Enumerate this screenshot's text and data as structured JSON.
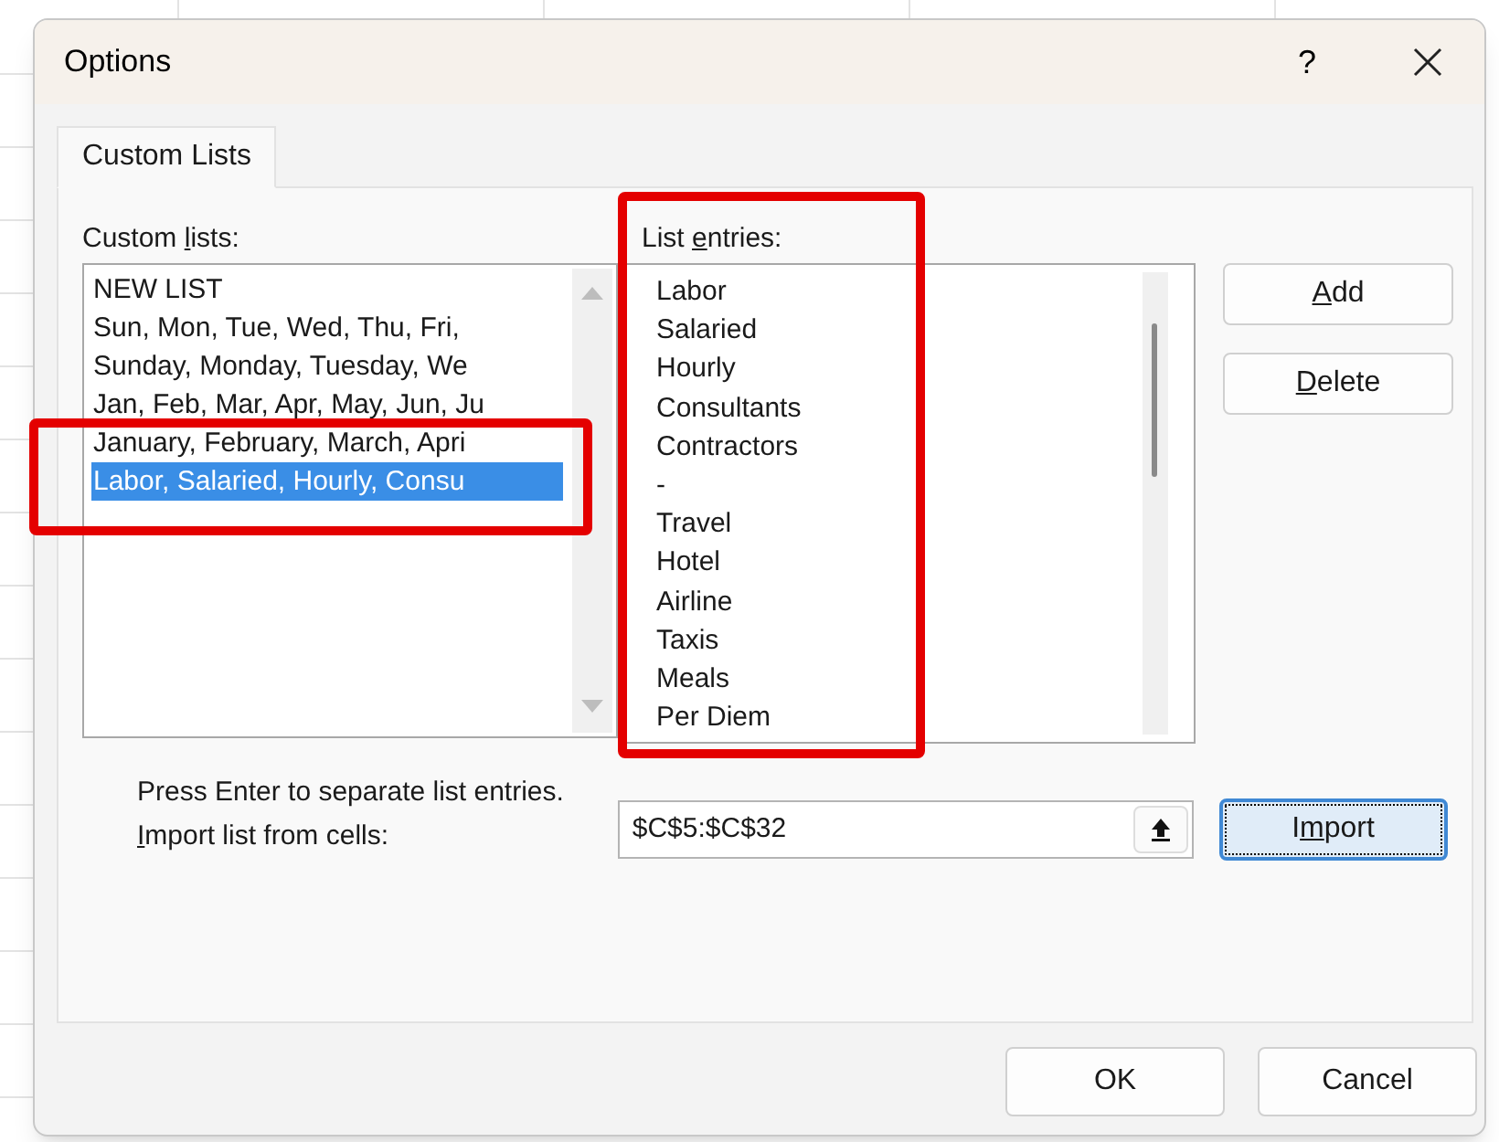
{
  "window": {
    "title": "Options",
    "help": "?"
  },
  "tabs": [
    {
      "label": "Custom Lists",
      "selected": true
    }
  ],
  "custom_lists": {
    "label": {
      "before": "Custom ",
      "key": "l",
      "after": "ists:"
    },
    "items": [
      {
        "text": "NEW LIST",
        "selected": false
      },
      {
        "text": "Sun, Mon, Tue, Wed, Thu, Fri,",
        "selected": false
      },
      {
        "text": "Sunday, Monday, Tuesday, We",
        "selected": false
      },
      {
        "text": "Jan, Feb, Mar, Apr, May, Jun, Ju",
        "selected": false
      },
      {
        "text": "January, February, March, Apri",
        "selected": false
      },
      {
        "text": "Labor, Salaried, Hourly, Consu",
        "selected": true
      }
    ]
  },
  "list_entries": {
    "label": {
      "before": "List ",
      "key": "e",
      "after": "ntries:"
    },
    "items": [
      "Labor",
      "Salaried",
      "Hourly",
      "Consultants",
      "Contractors",
      "-",
      "Travel",
      "Hotel",
      "Airline",
      "Taxis",
      "Meals",
      "Per Diem"
    ]
  },
  "side_buttons": [
    {
      "label": {
        "key": "A",
        "after": "dd"
      }
    },
    {
      "label": {
        "key": "D",
        "after": "elete"
      }
    }
  ],
  "hint": "Press Enter to separate list entries.",
  "import": {
    "label": {
      "key": "I",
      "after": "mport list from cells:"
    },
    "value": "$C$5:$C$32",
    "button": {
      "label": {
        "before": "I",
        "key": "m",
        "after": "port"
      },
      "focused": true
    }
  },
  "buttons": [
    "OK",
    "Cancel"
  ]
}
